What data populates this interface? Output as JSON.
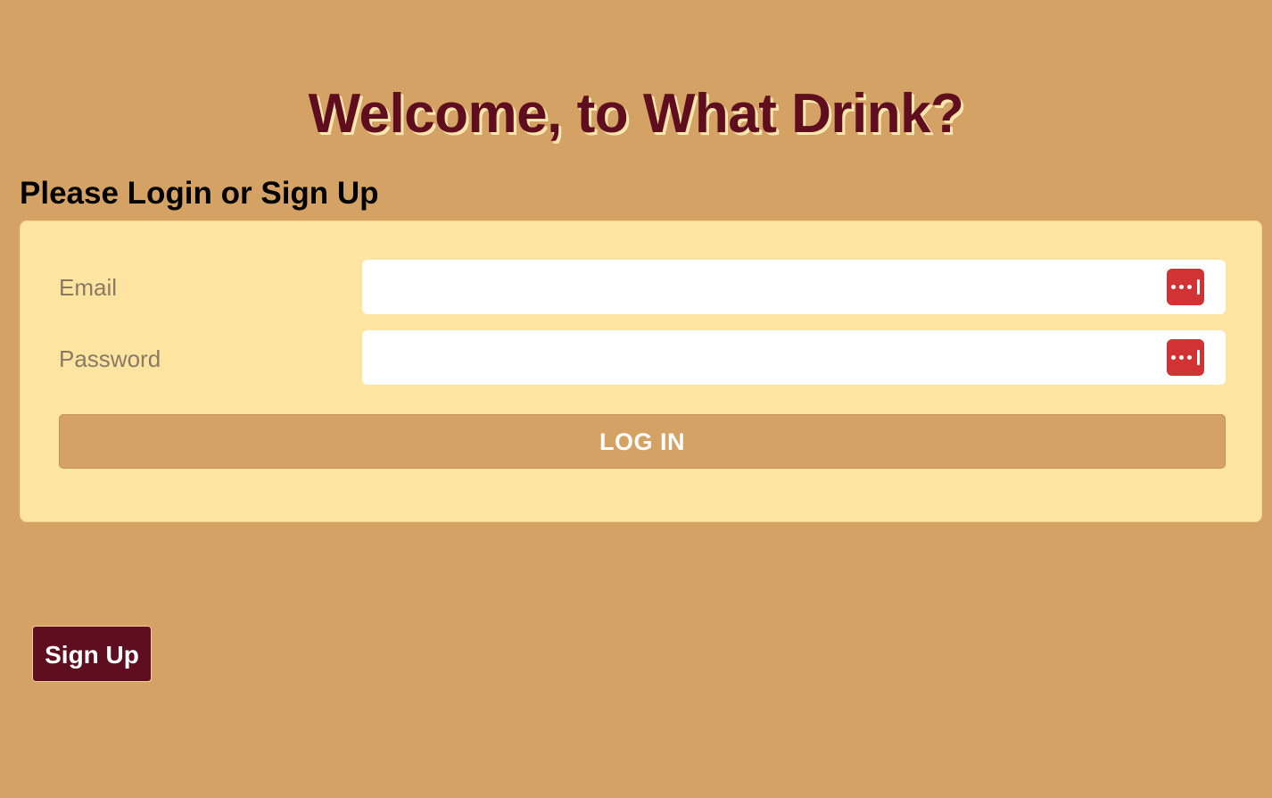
{
  "header": {
    "title": "Welcome, to What Drink?",
    "subtitle": "Please Login or Sign Up"
  },
  "login_form": {
    "email_label": "Email",
    "email_value": "",
    "password_label": "Password",
    "password_value": "",
    "password_manager_icon": "password-manager-icon",
    "login_button_label": "LOG IN"
  },
  "signup": {
    "button_label": "Sign Up"
  },
  "colors": {
    "background": "#d3a264",
    "card": "#fee4a1",
    "title": "#5e0e1f",
    "signup_button": "#5e0e1f",
    "password_manager_icon": "#d13234"
  }
}
